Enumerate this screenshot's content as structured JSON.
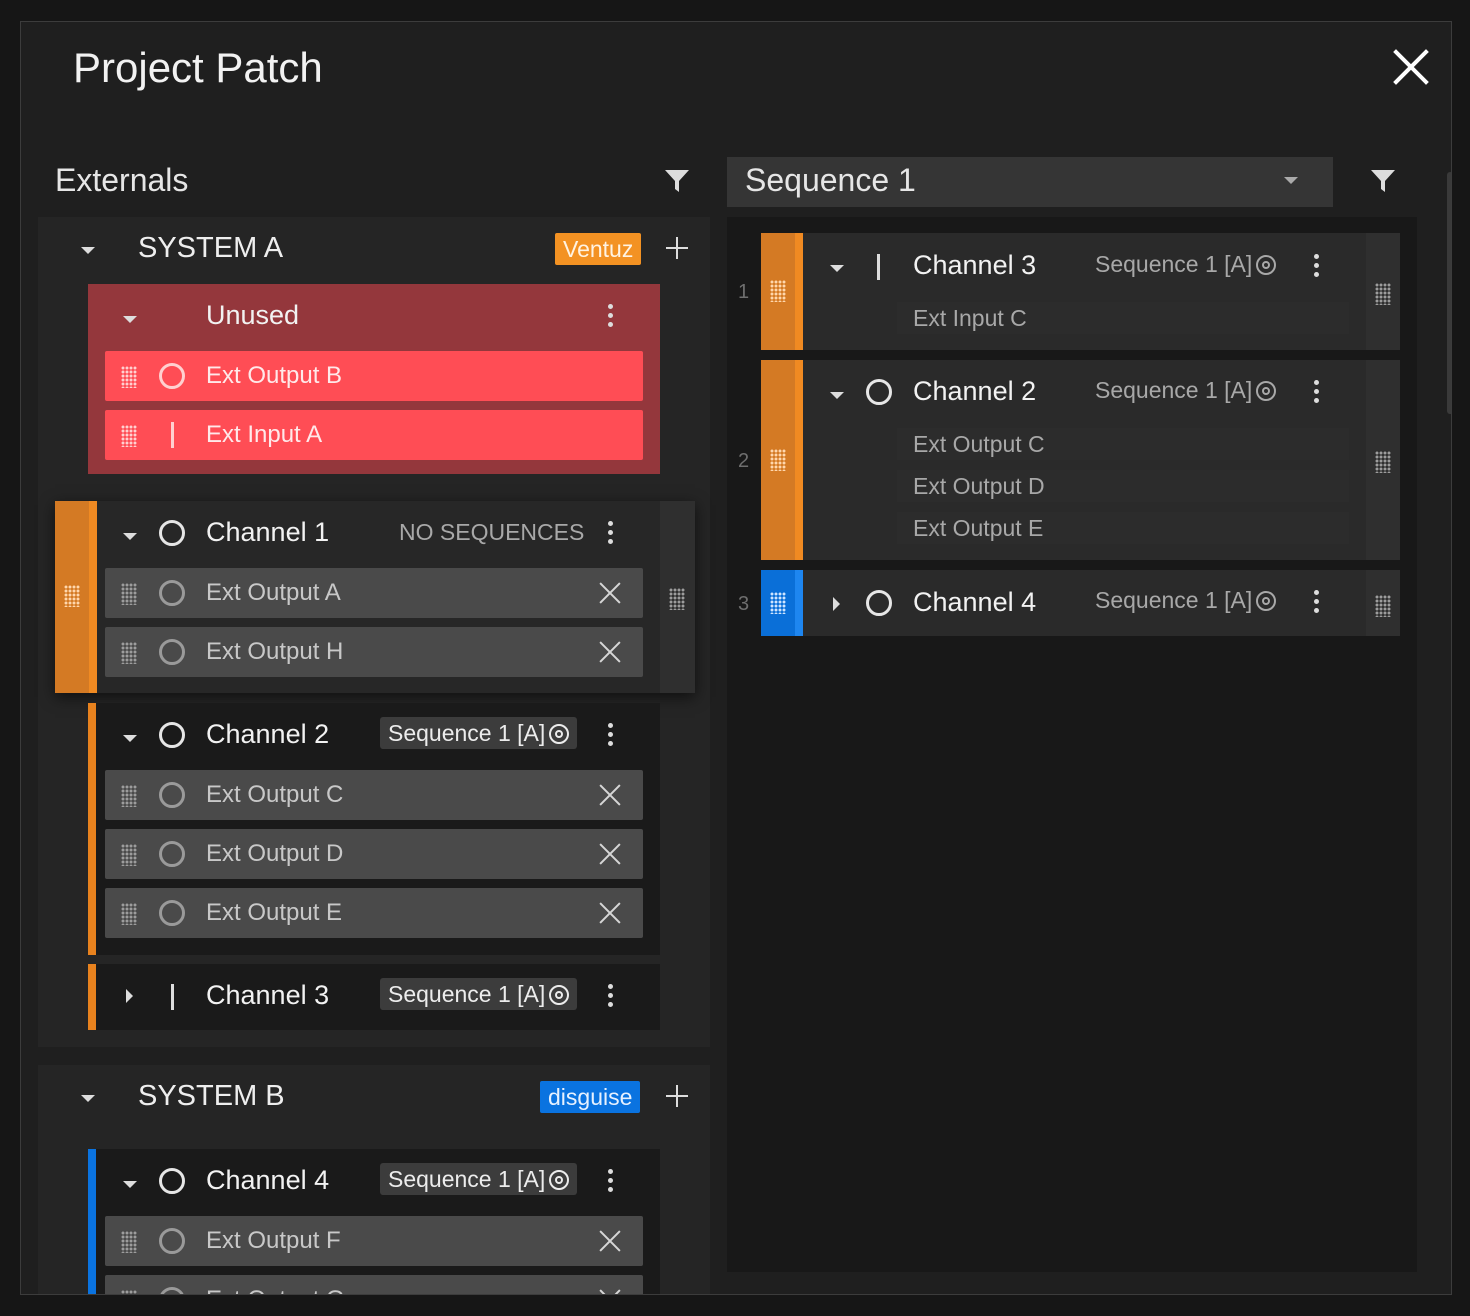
{
  "dialog": {
    "title": "Project Patch"
  },
  "externals": {
    "heading": "Externals",
    "systems": [
      {
        "name": "SYSTEM A",
        "tag": "Ventuz",
        "tag_color": "#f39223",
        "unused": {
          "label": "Unused",
          "items": [
            {
              "name": "Ext Output B",
              "kind": "output"
            },
            {
              "name": "Ext Input A",
              "kind": "input"
            }
          ]
        },
        "channels": [
          {
            "name": "Channel 1",
            "kind": "output",
            "sequence": "NO SEQUENCES",
            "expanded": true,
            "items": [
              {
                "name": "Ext Output A"
              },
              {
                "name": "Ext Output H"
              }
            ]
          },
          {
            "name": "Channel 2",
            "kind": "output",
            "sequence": "Sequence 1 [A]",
            "expanded": true,
            "items": [
              {
                "name": "Ext Output C"
              },
              {
                "name": "Ext Output D"
              },
              {
                "name": "Ext Output E"
              }
            ]
          },
          {
            "name": "Channel 3",
            "kind": "input",
            "sequence": "Sequence 1 [A]",
            "expanded": false,
            "items": []
          }
        ]
      },
      {
        "name": "SYSTEM B",
        "tag": "disguise",
        "tag_color": "#0a73e0",
        "channels": [
          {
            "name": "Channel 4",
            "kind": "output",
            "sequence": "Sequence 1 [A]",
            "expanded": true,
            "items": [
              {
                "name": "Ext Output F"
              },
              {
                "name": "Ext Output G"
              }
            ]
          }
        ]
      }
    ]
  },
  "sequence_panel": {
    "selected": "Sequence 1",
    "rows": [
      {
        "index": "1",
        "name": "Channel 3",
        "kind": "input",
        "sequence": "Sequence 1 [A]",
        "expanded": true,
        "color": "#e8821e",
        "items": [
          {
            "name": "Ext Input C"
          }
        ]
      },
      {
        "index": "2",
        "name": "Channel 2",
        "kind": "output",
        "sequence": "Sequence 1 [A]",
        "expanded": true,
        "color": "#e8821e",
        "items": [
          {
            "name": "Ext Output C"
          },
          {
            "name": "Ext Output D"
          },
          {
            "name": "Ext Output E"
          }
        ]
      },
      {
        "index": "3",
        "name": "Channel 4",
        "kind": "output",
        "sequence": "Sequence 1 [A]",
        "expanded": false,
        "color": "#0a73e0",
        "items": []
      }
    ]
  },
  "icons": {
    "close": "close-icon",
    "filter": "filter-icon",
    "drag": "drag-handle-icon",
    "more": "more-vertical-icon",
    "target": "target-icon"
  }
}
